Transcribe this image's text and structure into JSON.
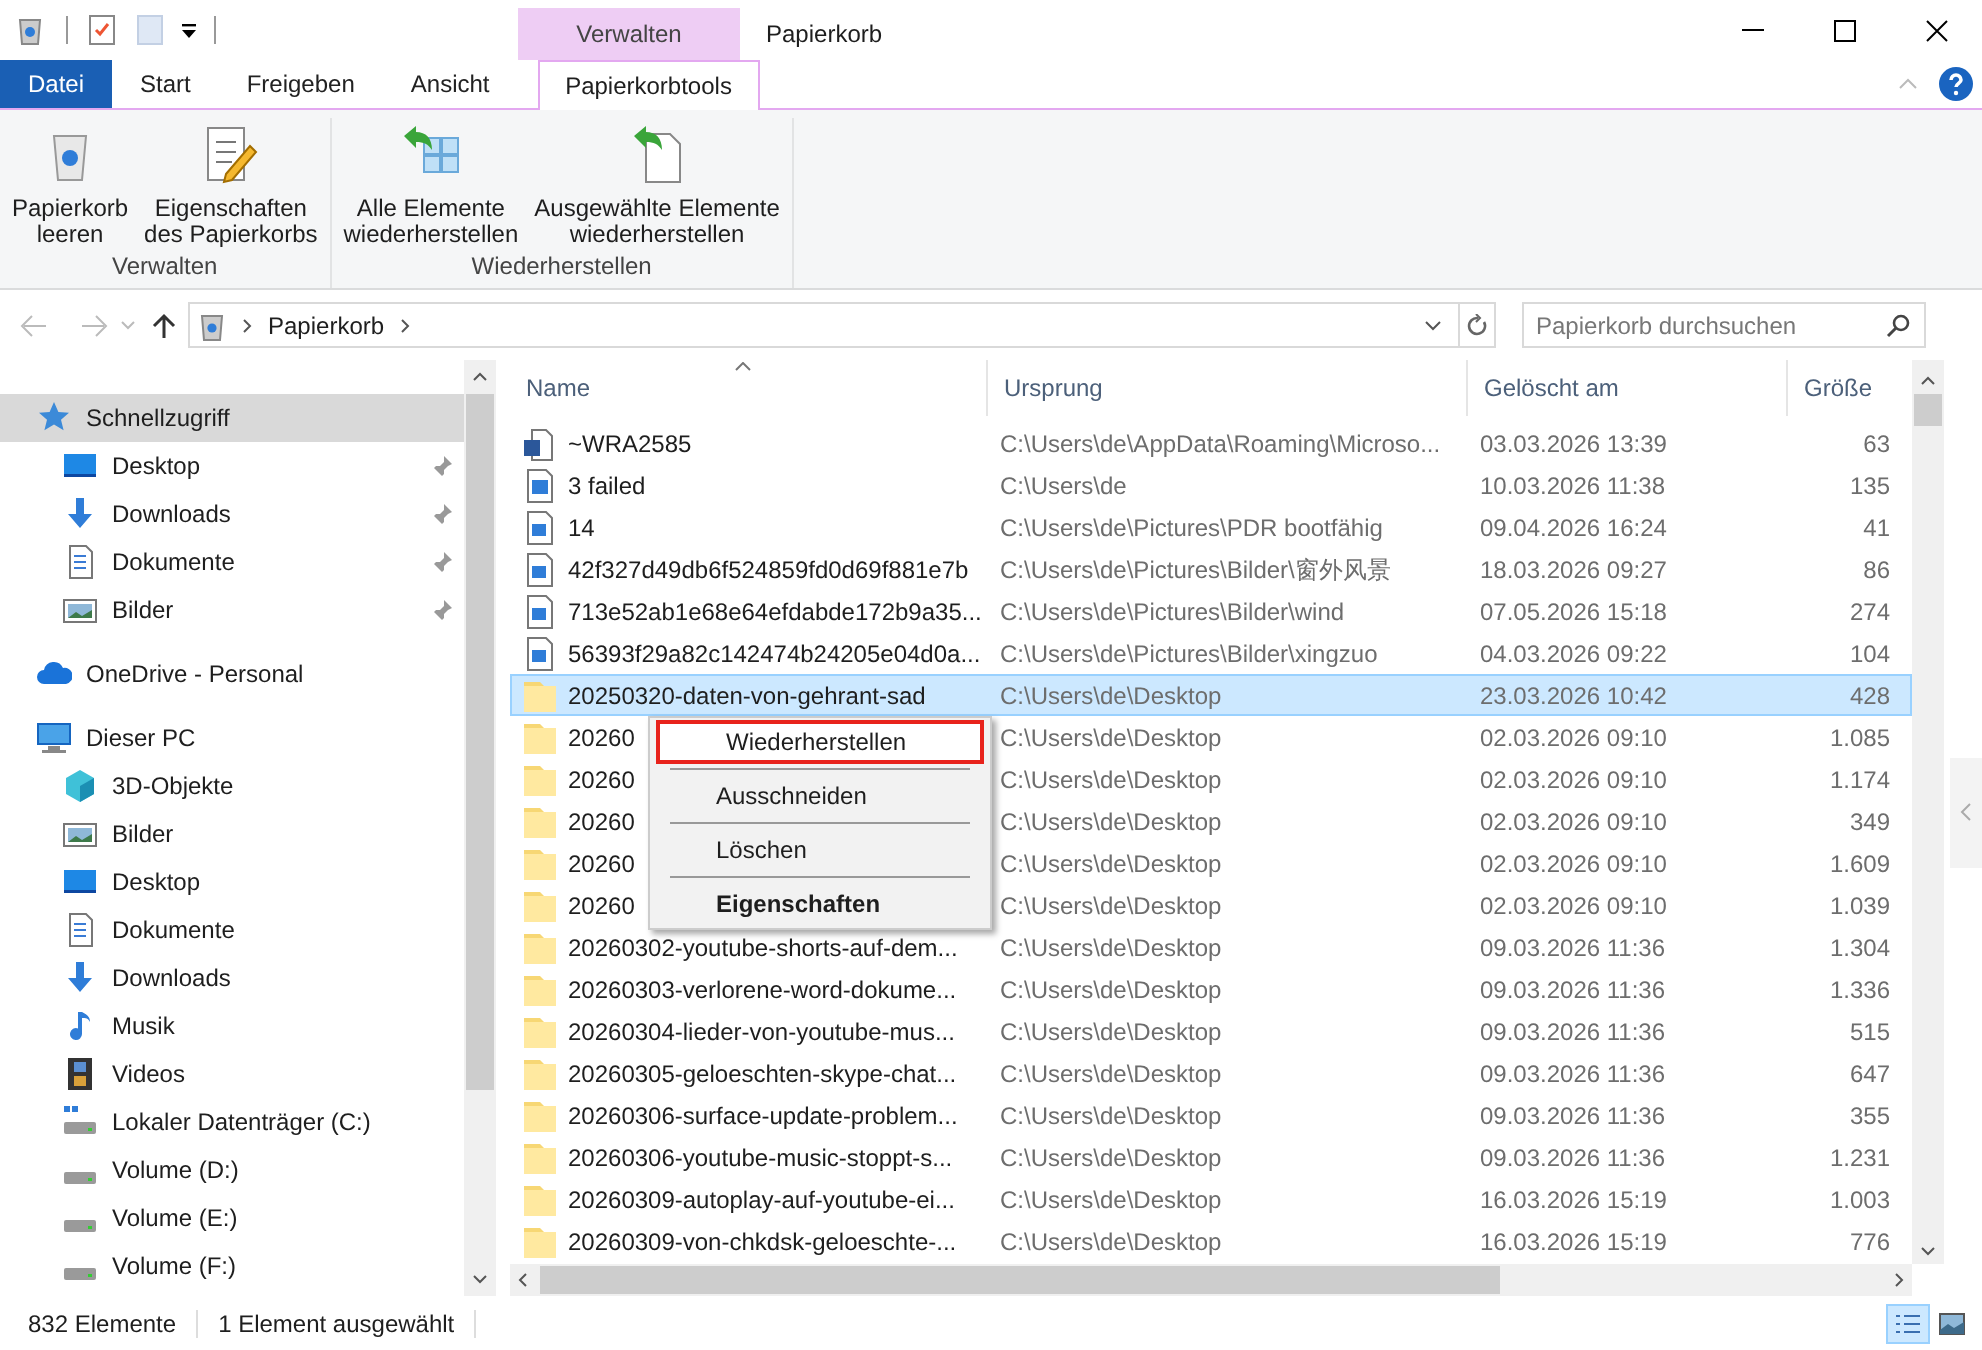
{
  "window": {
    "title": "Papierkorb",
    "context_tab_group": "Verwalten"
  },
  "ribbon_tabs": [
    {
      "label": "Datei",
      "kind": "file",
      "selected": false
    },
    {
      "label": "Start",
      "kind": "tab",
      "selected": false
    },
    {
      "label": "Freigeben",
      "kind": "tab",
      "selected": false
    },
    {
      "label": "Ansicht",
      "kind": "tab",
      "selected": false
    },
    {
      "label": "Papierkorbtools",
      "kind": "context",
      "selected": true
    }
  ],
  "ribbon_groups": [
    {
      "label": "Verwalten",
      "buttons": [
        {
          "label": "Papierkorb\nleeren",
          "kind": "bin"
        },
        {
          "label": "Eigenschaften\ndes Papierkorbs",
          "kind": "props"
        }
      ]
    },
    {
      "label": "Wiederherstellen",
      "buttons": [
        {
          "label": "Alle Elemente\nwiederherstellen",
          "kind": "restore-all"
        },
        {
          "label": "Ausgewählte Elemente\nwiederherstellen",
          "kind": "restore-sel"
        }
      ]
    }
  ],
  "address": {
    "path": [
      "Papierkorb"
    ]
  },
  "search": {
    "placeholder": "Papierkorb durchsuchen"
  },
  "sidebar": [
    {
      "label": "Schnellzugriff",
      "kind": "star",
      "selected": true,
      "children": [
        {
          "label": "Desktop",
          "kind": "desktop",
          "pinned": true
        },
        {
          "label": "Downloads",
          "kind": "download",
          "pinned": true
        },
        {
          "label": "Dokumente",
          "kind": "docs",
          "pinned": true
        },
        {
          "label": "Bilder",
          "kind": "pictures",
          "pinned": true
        }
      ]
    },
    {
      "label": "OneDrive - Personal",
      "kind": "cloud",
      "selected": false
    },
    {
      "label": "Dieser PC",
      "kind": "pc",
      "selected": false,
      "children": [
        {
          "label": "3D-Objekte",
          "kind": "cube",
          "pinned": false
        },
        {
          "label": "Bilder",
          "kind": "pictures",
          "pinned": false
        },
        {
          "label": "Desktop",
          "kind": "desktop",
          "pinned": false
        },
        {
          "label": "Dokumente",
          "kind": "docs",
          "pinned": false
        },
        {
          "label": "Downloads",
          "kind": "download",
          "pinned": false
        },
        {
          "label": "Musik",
          "kind": "music",
          "pinned": false
        },
        {
          "label": "Videos",
          "kind": "video",
          "pinned": false
        },
        {
          "label": "Lokaler Datenträger (C:)",
          "kind": "sysdrive",
          "pinned": false
        },
        {
          "label": "Volume (D:)",
          "kind": "drive",
          "pinned": false
        },
        {
          "label": "Volume (E:)",
          "kind": "drive",
          "pinned": false
        },
        {
          "label": "Volume (F:)",
          "kind": "drive",
          "pinned": false
        }
      ]
    }
  ],
  "table": {
    "columns": [
      "Name",
      "Ursprung",
      "Gelöscht am",
      "Größe"
    ],
    "rows": [
      {
        "kind": "word",
        "name": "~WRA2585",
        "origin": "C:\\Users\\de\\AppData\\Roaming\\Microso...",
        "deleted": "03.03.2026 13:39",
        "size": "63",
        "selected": false
      },
      {
        "kind": "app",
        "name": "3 failed",
        "origin": "C:\\Users\\de",
        "deleted": "10.03.2026 11:38",
        "size": "135",
        "selected": false
      },
      {
        "kind": "image",
        "name": "14",
        "origin": "C:\\Users\\de\\Pictures\\PDR bootfähig",
        "deleted": "09.04.2026 16:24",
        "size": "41",
        "selected": false
      },
      {
        "kind": "image",
        "name": "42f327d49db6f524859fd0d69f881e7b",
        "origin": "C:\\Users\\de\\Pictures\\Bilder\\窗外风景",
        "deleted": "18.03.2026 09:27",
        "size": "86",
        "selected": false
      },
      {
        "kind": "image",
        "name": "713e52ab1e68e64efdabde172b9a35...",
        "origin": "C:\\Users\\de\\Pictures\\Bilder\\wind",
        "deleted": "07.05.2026 15:18",
        "size": "274",
        "selected": false
      },
      {
        "kind": "image",
        "name": "56393f29a82c142474b24205e04d0a...",
        "origin": "C:\\Users\\de\\Pictures\\Bilder\\xingzuo",
        "deleted": "04.03.2026 09:22",
        "size": "104",
        "selected": false
      },
      {
        "kind": "folder",
        "name": "20250320-daten-von-gehrant-sad",
        "origin": "C:\\Users\\de\\Desktop",
        "deleted": "23.03.2026 10:42",
        "size": "428",
        "selected": true
      },
      {
        "kind": "folder",
        "name": "20260",
        "origin": "C:\\Users\\de\\Desktop",
        "deleted": "02.03.2026 09:10",
        "size": "1.085",
        "selected": false
      },
      {
        "kind": "folder",
        "name": "20260",
        "origin": "C:\\Users\\de\\Desktop",
        "deleted": "02.03.2026 09:10",
        "size": "1.174",
        "selected": false
      },
      {
        "kind": "folder",
        "name": "20260",
        "origin": "C:\\Users\\de\\Desktop",
        "deleted": "02.03.2026 09:10",
        "size": "349",
        "selected": false
      },
      {
        "kind": "folder",
        "name": "20260",
        "origin": "C:\\Users\\de\\Desktop",
        "deleted": "02.03.2026 09:10",
        "size": "1.609",
        "selected": false
      },
      {
        "kind": "folder",
        "name": "20260",
        "origin": "C:\\Users\\de\\Desktop",
        "deleted": "02.03.2026 09:10",
        "size": "1.039",
        "selected": false
      },
      {
        "kind": "folder",
        "name": "20260302-youtube-shorts-auf-dem...",
        "origin": "C:\\Users\\de\\Desktop",
        "deleted": "09.03.2026 11:36",
        "size": "1.304",
        "selected": false
      },
      {
        "kind": "folder",
        "name": "20260303-verlorene-word-dokume...",
        "origin": "C:\\Users\\de\\Desktop",
        "deleted": "09.03.2026 11:36",
        "size": "1.336",
        "selected": false
      },
      {
        "kind": "folder",
        "name": "20260304-lieder-von-youtube-mus...",
        "origin": "C:\\Users\\de\\Desktop",
        "deleted": "09.03.2026 11:36",
        "size": "515",
        "selected": false
      },
      {
        "kind": "folder",
        "name": "20260305-geloeschten-skype-chat...",
        "origin": "C:\\Users\\de\\Desktop",
        "deleted": "09.03.2026 11:36",
        "size": "647",
        "selected": false
      },
      {
        "kind": "folder",
        "name": "20260306-surface-update-problem...",
        "origin": "C:\\Users\\de\\Desktop",
        "deleted": "09.03.2026 11:36",
        "size": "355",
        "selected": false
      },
      {
        "kind": "folder",
        "name": "20260306-youtube-music-stoppt-s...",
        "origin": "C:\\Users\\de\\Desktop",
        "deleted": "09.03.2026 11:36",
        "size": "1.231",
        "selected": false
      },
      {
        "kind": "folder",
        "name": "20260309-autoplay-auf-youtube-ei...",
        "origin": "C:\\Users\\de\\Desktop",
        "deleted": "16.03.2026 15:19",
        "size": "1.003",
        "selected": false
      },
      {
        "kind": "folder",
        "name": "20260309-von-chkdsk-geloeschte-...",
        "origin": "C:\\Users\\de\\Desktop",
        "deleted": "16.03.2026 15:19",
        "size": "776",
        "selected": false
      }
    ]
  },
  "context_menu": [
    {
      "label": "Wiederherstellen",
      "highlighted": true,
      "bold": false
    },
    {
      "label": "Ausschneiden",
      "highlighted": false,
      "bold": false
    },
    {
      "label": "Löschen",
      "highlighted": false,
      "bold": false
    },
    {
      "label": "Eigenschaften",
      "highlighted": false,
      "bold": true
    }
  ],
  "status_bar": {
    "items": [
      "832 Elemente",
      "1 Element ausgewählt"
    ],
    "views": [
      {
        "kind": "details",
        "selected": true
      },
      {
        "kind": "tiles",
        "selected": false
      }
    ]
  }
}
